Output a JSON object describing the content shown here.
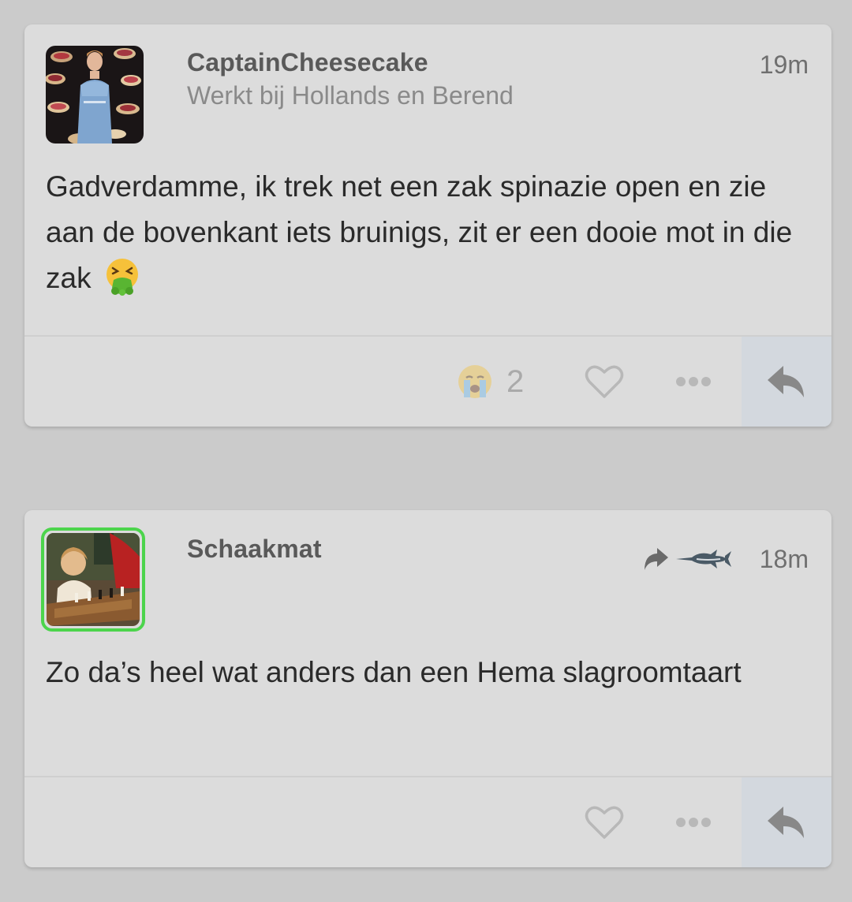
{
  "posts": [
    {
      "username": "CaptainCheesecake",
      "subtitle": "Werkt bij Hollands en Berend",
      "time": "19m",
      "text": "Gadverdamme, ik trek net een zak spinazie open en zie aan de bovenkant iets bruinigs, zit er een dooie mot in die zak",
      "text_emoji": "vomiting-face-emoji",
      "reaction_icon": "crying-face-emoji",
      "reaction_count": "2",
      "icons": [
        "heart-icon",
        "more-dots-icon",
        "reply-arrow-icon"
      ]
    },
    {
      "username": "Schaakmat",
      "time": "18m",
      "repost_icon": "repost-arrow-icon",
      "repost_badge_icon": "swordfish-icon",
      "avatar_ring_color": "#4cd44c",
      "text": "Zo da’s heel wat anders dan een Hema slagroomtaart",
      "icons": [
        "heart-icon",
        "more-dots-icon",
        "reply-arrow-icon"
      ]
    }
  ],
  "colors": {
    "background": "#cbcbcb",
    "card": "#dcdcdc",
    "reply_box": "#d3d8de",
    "username": "#595959",
    "subtitle": "#8a8a8a",
    "body_text": "#2a2a2a",
    "online_ring": "#4cd44c"
  }
}
